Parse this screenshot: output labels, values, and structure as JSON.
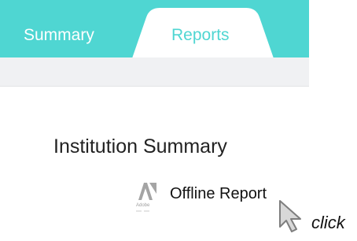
{
  "tabs": [
    {
      "label": "Summary",
      "active": false
    },
    {
      "label": "Reports",
      "active": true
    }
  ],
  "colors": {
    "tab_bar": "#4fd6d2",
    "subbar": "#f0f1f3",
    "text": "#222222"
  },
  "main": {
    "title": "Institution Summary",
    "report": {
      "icon": "adobe-pdf-icon",
      "icon_text": "Adobe",
      "label": "Offline Report"
    }
  },
  "cursor": {
    "icon": "mouse-pointer-icon",
    "caption": "click"
  }
}
